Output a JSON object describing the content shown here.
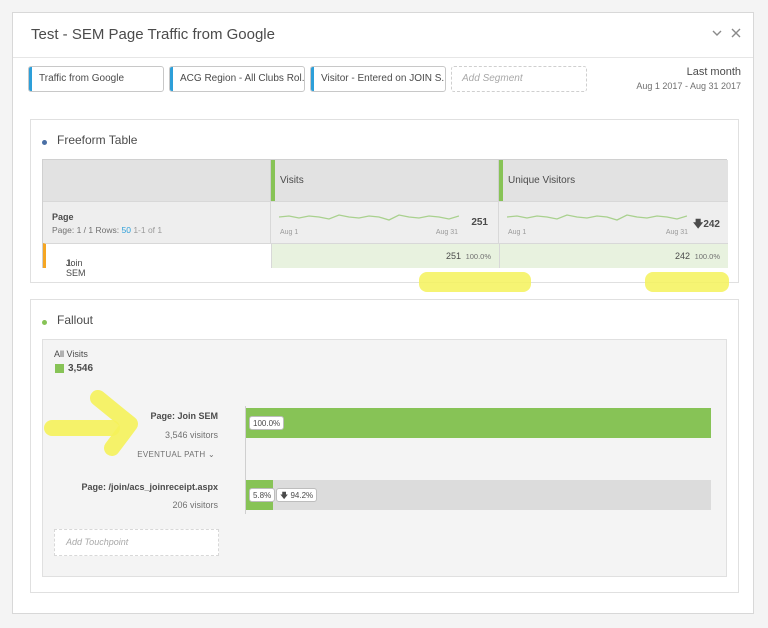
{
  "panel": {
    "title": "Test - SEM Page Traffic from Google",
    "collapse_icon": "chevron-down-icon",
    "close_icon": "close-icon",
    "segments": [
      "Traffic from Google",
      "ACG Region - All Clubs Rol...",
      "Visitor - Entered on JOIN S..."
    ],
    "add_segment_placeholder": "Add Segment",
    "date_range_label": "Last month",
    "date_range_value": "Aug 1 2017 - Aug 31 2017"
  },
  "freeform": {
    "title": "Freeform Table",
    "columns": [
      "Visits",
      "Unique Visitors"
    ],
    "dimension": "Page",
    "page_info": "Page: 1 / 1 Rows:",
    "rows_per_page": "50",
    "range": "1-1 of 1",
    "totals": [
      "251",
      "242"
    ],
    "unique_total_icon": "arrow-down-icon",
    "sparkline_start": "Aug 1",
    "sparkline_end": "Aug 31",
    "rows": [
      {
        "index": "1.",
        "label": "Join SEM",
        "visits": "251",
        "visits_pct": "100.0%",
        "visitors": "242",
        "visitors_pct": "100.0%"
      }
    ]
  },
  "fallout": {
    "title": "Fallout",
    "all_visits_label": "All Visits",
    "all_visits_value": "3,546",
    "steps": [
      {
        "name": "Page: Join SEM",
        "count": "3,546 visitors",
        "percent": "100.0%",
        "fill": 1.0
      },
      {
        "name": "Page: /join/acs_joinreceipt.aspx",
        "count": "206 visitors",
        "percent": "5.8%",
        "fill": 0.058,
        "drop": "94.2%"
      }
    ],
    "eventual_path": "EVENTUAL PATH",
    "add_touchpoint": "Add Touchpoint"
  },
  "colors": {
    "accent_blue": "#2d9fd9",
    "fallout_green": "#87c356",
    "row_accent_orange": "#f5a623",
    "highlighter_yellow": "#f5f25a"
  }
}
